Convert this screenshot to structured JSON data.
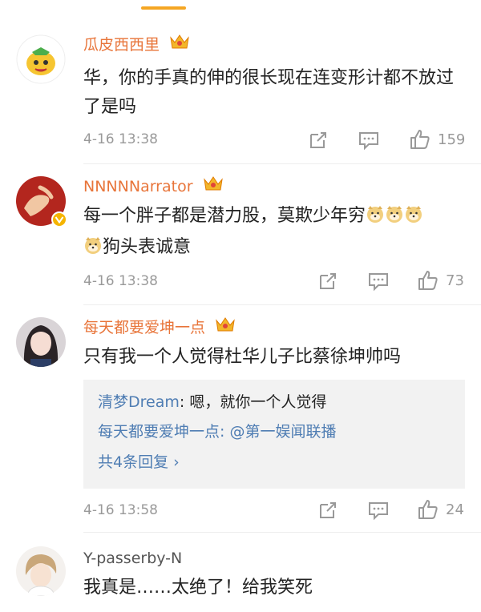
{
  "comments": [
    {
      "username": "瓜皮西西里",
      "text": "华，你的手真的伸的很长现在连变形计都不放过了是吗",
      "timestamp": "4-16 13:38",
      "likes": "159",
      "username_color": "#e8753a"
    },
    {
      "username": "NNNNNarrator",
      "text_main": "每一个胖子都是潜力股，莫欺少年穷",
      "text_second": "狗头表诚意",
      "timestamp": "4-16 13:38",
      "likes": "73",
      "username_color": "#e8753a"
    },
    {
      "username": "每天都要爱坤一点",
      "text": "只有我一个人觉得杜华儿子比蔡徐坤帅吗",
      "timestamp": "4-16 13:58",
      "likes": "24",
      "username_color": "#e8753a",
      "replies": [
        {
          "author": "清梦Dream",
          "sep": ": ",
          "body": "嗯，就你一个人觉得"
        },
        {
          "author": "每天都要爱坤一点",
          "sep": ": ",
          "body": "@第一娱闻联播"
        }
      ],
      "more_replies": "共4条回复 ›"
    },
    {
      "username": "Y-passerby-N",
      "text": "我真是……太绝了！给我笑死",
      "username_color": "#555555"
    }
  ]
}
